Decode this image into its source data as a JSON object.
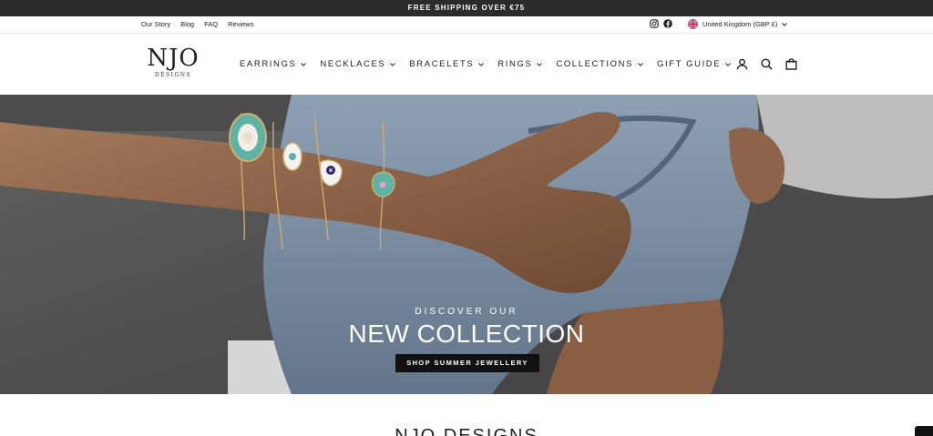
{
  "announcement": "FREE SHIPPING OVER €75",
  "utility_links": [
    "Our Story",
    "Blog",
    "FAQ",
    "Reviews"
  ],
  "social_icons": [
    "instagram-icon",
    "facebook-icon"
  ],
  "locale": {
    "label": "United Kingdom (GBP £)",
    "flag": "uk-flag-icon"
  },
  "logo": {
    "main": "NJO",
    "sub": "DESIGNS"
  },
  "nav": [
    "EARRINGS",
    "NECKLACES",
    "BRACELETS",
    "RINGS",
    "COLLECTIONS",
    "GIFT GUIDE"
  ],
  "header_actions": [
    "account-icon",
    "search-icon",
    "cart-icon"
  ],
  "hero": {
    "eyebrow": "DISCOVER OUR",
    "headline": "NEW COLLECTION",
    "cta": "SHOP SUMMER JEWELLERY"
  },
  "section_title": "NJO DESIGNS",
  "colors": {
    "announcement_bg": "#2b2b2b",
    "cta_bg": "#111111",
    "accent_turquoise": "#5fb3a6"
  }
}
